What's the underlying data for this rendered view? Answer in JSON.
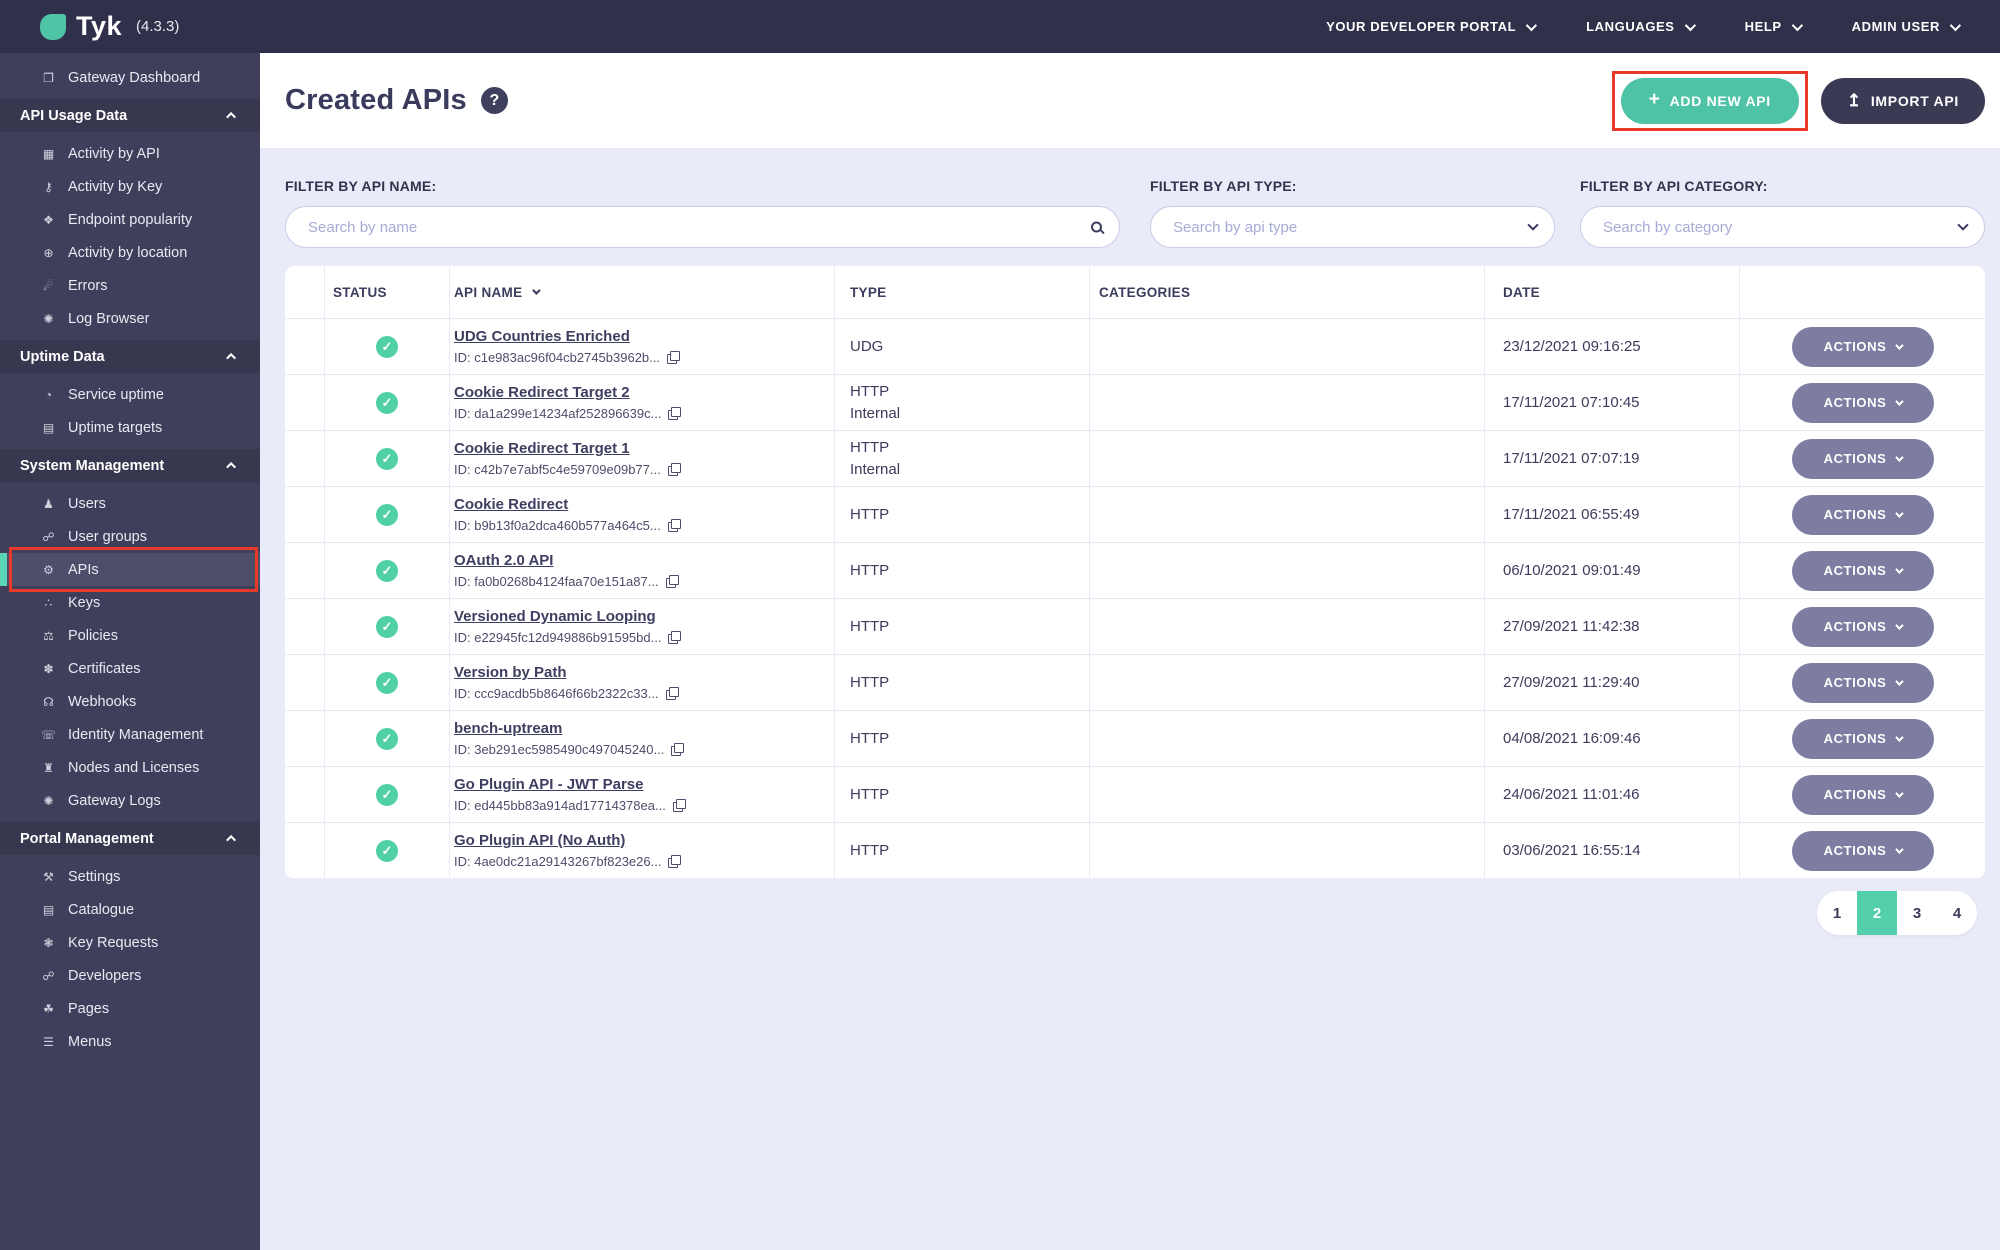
{
  "brand": {
    "logo": "Tyk",
    "version": "(4.3.3)"
  },
  "header": {
    "nav": [
      {
        "label": "YOUR DEVELOPER PORTAL"
      },
      {
        "label": "LANGUAGES"
      },
      {
        "label": "HELP"
      },
      {
        "label": "ADMIN USER"
      }
    ]
  },
  "icons": {
    "monitor": "❒",
    "chart": "▦",
    "key": "⚷",
    "fork": "❖",
    "globe": "⊕",
    "bomb": "☄",
    "bug": "✺",
    "gauge": "◔",
    "list": "▤",
    "user": "♟",
    "users": "☍",
    "gears": "⚙",
    "sitemap": "∴",
    "shield": "⚖",
    "certificate": "✽",
    "bell": "☊",
    "phone": "☏",
    "bank": "♜",
    "wrench": "⚒",
    "paw": "❃",
    "leaf": "☘",
    "menu": "☰"
  },
  "sidebar": {
    "items": [
      {
        "type": "link",
        "label": "Gateway Dashboard",
        "icon": "monitor"
      },
      {
        "type": "section",
        "label": "API Usage Data"
      },
      {
        "type": "link",
        "label": "Activity by API",
        "icon": "chart"
      },
      {
        "type": "link",
        "label": "Activity by Key",
        "icon": "key"
      },
      {
        "type": "link",
        "label": "Endpoint popularity",
        "icon": "fork"
      },
      {
        "type": "link",
        "label": "Activity by location",
        "icon": "globe"
      },
      {
        "type": "link",
        "label": "Errors",
        "icon": "bomb"
      },
      {
        "type": "link",
        "label": "Log Browser",
        "icon": "bug"
      },
      {
        "type": "section",
        "label": "Uptime Data"
      },
      {
        "type": "link",
        "label": "Service uptime",
        "icon": "gauge"
      },
      {
        "type": "link",
        "label": "Uptime targets",
        "icon": "list"
      },
      {
        "type": "section",
        "label": "System Management"
      },
      {
        "type": "link",
        "label": "Users",
        "icon": "user"
      },
      {
        "type": "link",
        "label": "User groups",
        "icon": "users"
      },
      {
        "type": "link",
        "label": "APIs",
        "icon": "gears",
        "selected": true,
        "annotated": true
      },
      {
        "type": "link",
        "label": "Keys",
        "icon": "sitemap"
      },
      {
        "type": "link",
        "label": "Policies",
        "icon": "shield"
      },
      {
        "type": "link",
        "label": "Certificates",
        "icon": "certificate"
      },
      {
        "type": "link",
        "label": "Webhooks",
        "icon": "bell"
      },
      {
        "type": "link",
        "label": "Identity Management",
        "icon": "phone"
      },
      {
        "type": "link",
        "label": "Nodes and Licenses",
        "icon": "bank"
      },
      {
        "type": "link",
        "label": "Gateway Logs",
        "icon": "bug"
      },
      {
        "type": "section",
        "label": "Portal Management"
      },
      {
        "type": "link",
        "label": "Settings",
        "icon": "wrench"
      },
      {
        "type": "link",
        "label": "Catalogue",
        "icon": "list"
      },
      {
        "type": "link",
        "label": "Key Requests",
        "icon": "paw"
      },
      {
        "type": "link",
        "label": "Developers",
        "icon": "users"
      },
      {
        "type": "link",
        "label": "Pages",
        "icon": "leaf"
      },
      {
        "type": "link",
        "label": "Menus",
        "icon": "menu"
      }
    ]
  },
  "page": {
    "title": "Created APIs",
    "help": "?",
    "add_api_label": "ADD NEW API",
    "import_api_label": "IMPORT API"
  },
  "filters": {
    "name": {
      "label": "FILTER BY API NAME:",
      "placeholder": "Search by name"
    },
    "type": {
      "label": "FILTER BY API TYPE:",
      "placeholder": "Search by api type"
    },
    "category": {
      "label": "FILTER BY API CATEGORY:",
      "placeholder": "Search by category"
    }
  },
  "table": {
    "columns": [
      "STATUS",
      "API NAME",
      "TYPE",
      "CATEGORIES",
      "DATE"
    ],
    "actions_label": "ACTIONS",
    "rows": [
      {
        "name": "UDG Countries Enriched",
        "id": "ID: c1e983ac96f04cb2745b3962b...",
        "type": "UDG",
        "date": "23/12/2021 09:16:25"
      },
      {
        "name": "Cookie Redirect Target 2",
        "id": "ID: da1a299e14234af252896639c...",
        "type": "HTTP",
        "type2": "Internal",
        "date": "17/11/2021 07:10:45"
      },
      {
        "name": "Cookie Redirect Target 1",
        "id": "ID: c42b7e7abf5c4e59709e09b77...",
        "type": "HTTP",
        "type2": "Internal",
        "date": "17/11/2021 07:07:19"
      },
      {
        "name": "Cookie Redirect",
        "id": "ID: b9b13f0a2dca460b577a464c5...",
        "type": "HTTP",
        "date": "17/11/2021 06:55:49"
      },
      {
        "name": "OAuth 2.0 API",
        "id": "ID: fa0b0268b4124faa70e151a87...",
        "type": "HTTP",
        "date": "06/10/2021 09:01:49"
      },
      {
        "name": "Versioned Dynamic Looping",
        "id": "ID: e22945fc12d949886b91595bd...",
        "type": "HTTP",
        "date": "27/09/2021 11:42:38"
      },
      {
        "name": "Version by Path",
        "id": "ID: ccc9acdb5b8646f66b2322c33...",
        "type": "HTTP",
        "date": "27/09/2021 11:29:40"
      },
      {
        "name": "bench-uptream",
        "id": "ID: 3eb291ec5985490c497045240...",
        "type": "HTTP",
        "date": "04/08/2021 16:09:46"
      },
      {
        "name": "Go Plugin API - JWT Parse",
        "id": "ID: ed445bb83a914ad17714378ea...",
        "type": "HTTP",
        "date": "24/06/2021 11:01:46"
      },
      {
        "name": "Go Plugin API (No Auth)",
        "id": "ID: 4ae0dc21a29143267bf823e26...",
        "type": "HTTP",
        "date": "03/06/2021 16:55:14"
      }
    ]
  },
  "pagination": {
    "pages": [
      "1",
      "2",
      "3",
      "4"
    ],
    "current": "2"
  },
  "colors": {
    "accent_teal": "#4EC3A5",
    "annotation_red": "#E8392B",
    "header_bg": "#30304A",
    "sidebar_bg": "#3F3F5C",
    "status_green": "#4FD0A5",
    "actions_grey": "#7D7DA1"
  }
}
